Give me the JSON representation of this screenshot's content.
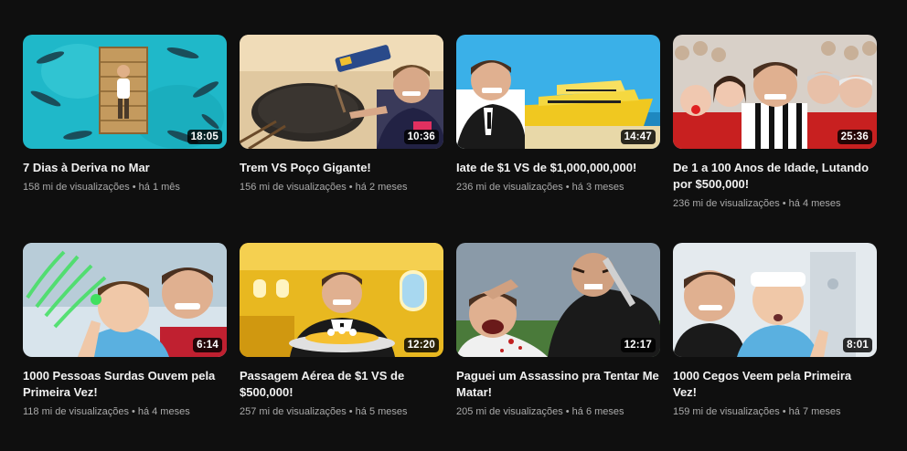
{
  "videos": [
    {
      "title": "7 Dias à Deriva no Mar",
      "views": "158 mi de visualizações",
      "age": "há 1 mês",
      "duration": "18:05"
    },
    {
      "title": "Trem VS Poço Gigante!",
      "views": "156 mi de visualizações",
      "age": "há 2 meses",
      "duration": "10:36"
    },
    {
      "title": "Iate de $1 VS de $1,000,000,000!",
      "views": "236 mi de visualizações",
      "age": "há 3 meses",
      "duration": "14:47"
    },
    {
      "title": "De 1 a 100 Anos de Idade, Lutando por $500,000!",
      "views": "236 mi de visualizações",
      "age": "há 4 meses",
      "duration": "25:36"
    },
    {
      "title": "1000 Pessoas Surdas Ouvem pela Primeira Vez!",
      "views": "118 mi de visualizações",
      "age": "há 4 meses",
      "duration": "6:14"
    },
    {
      "title": "Passagem Aérea de $1 VS de $500,000!",
      "views": "257 mi de visualizações",
      "age": "há 5 meses",
      "duration": "12:20"
    },
    {
      "title": "Paguei um Assassino pra Tentar Me Matar!",
      "views": "205 mi de visualizações",
      "age": "há 6 meses",
      "duration": "12:17"
    },
    {
      "title": "1000 Cegos Veem pela Primeira Vez!",
      "views": "159 mi de visualizações",
      "age": "há 7 meses",
      "duration": "8:01"
    }
  ],
  "separator": "•"
}
